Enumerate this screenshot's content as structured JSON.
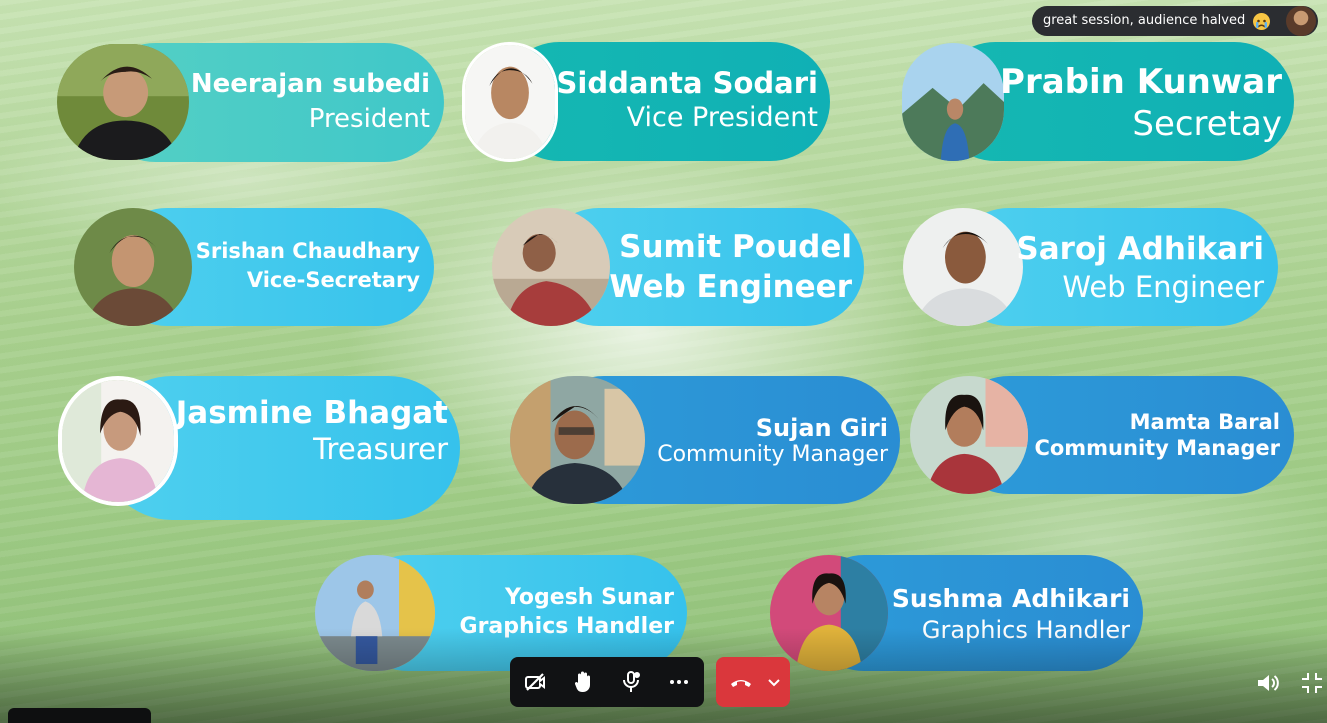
{
  "toast": {
    "message": "great session, audience halved",
    "emoji": "crying-face-emoji"
  },
  "members": [
    {
      "name": "Neerajan subedi",
      "role": "President"
    },
    {
      "name": "Siddanta Sodari",
      "role": "Vice President"
    },
    {
      "name": "Prabin Kunwar",
      "role": "Secretay"
    },
    {
      "name": "Srishan Chaudhary",
      "role": "Vice-Secretary"
    },
    {
      "name": "Sumit Poudel",
      "role": "Web Engineer"
    },
    {
      "name": "Saroj Adhikari",
      "role": "Web Engineer"
    },
    {
      "name": "Jasmine Bhagat",
      "role": "Treasurer"
    },
    {
      "name": "Sujan Giri",
      "role": "Community Manager"
    },
    {
      "name": "Mamta Baral",
      "role": "Community Manager"
    },
    {
      "name": "Yogesh Sunar",
      "role": "Graphics Handler"
    },
    {
      "name": "Sushma Adhikari",
      "role": "Graphics Handler"
    }
  ],
  "controls": {
    "items": [
      "camera-off-icon",
      "raise-hand-icon",
      "screen-share-icon",
      "more-options-icon"
    ],
    "hangup": "hang-up-icon"
  },
  "colors": {
    "teal": "#3fc7c9",
    "sky": "#36c2ec",
    "blue": "#2a8dd3",
    "hangup": "#da373c",
    "bar": "#111214"
  }
}
